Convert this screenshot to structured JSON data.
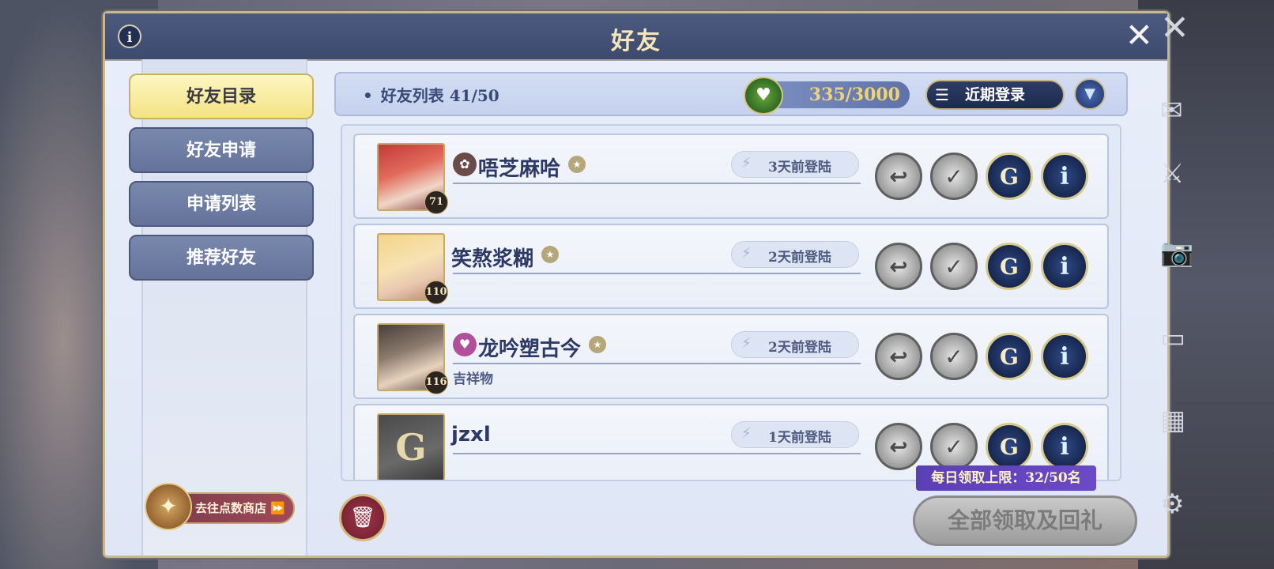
{
  "title": "好友",
  "tabs": [
    {
      "label": "好友目录",
      "active": true
    },
    {
      "label": "好友申请",
      "active": false
    },
    {
      "label": "申请列表",
      "active": false
    },
    {
      "label": "推荐好友",
      "active": false
    }
  ],
  "shop_button": {
    "label": "去往点数商店"
  },
  "header": {
    "friend_count_label": "好友列表 41/50",
    "points": "335/3000",
    "sort_label": "近期登录"
  },
  "friends": [
    {
      "name": "唔芝麻哈",
      "level": "71",
      "login": "3天前登陆",
      "subtitle": ""
    },
    {
      "name": "笑熬浆糊",
      "level": "110",
      "login": "2天前登陆",
      "subtitle": ""
    },
    {
      "name": "龙吟塑古今",
      "level": "116",
      "login": "2天前登陆",
      "subtitle": "吉祥物"
    },
    {
      "name": "jzxl",
      "level": "",
      "login": "1天前登陆",
      "subtitle": ""
    }
  ],
  "claim_tip": "每日领取上限：32/50名",
  "claim_all_label": "全部领取及回礼",
  "icons": {
    "close": "close-icon",
    "info": "info-icon",
    "delete": "trash-icon",
    "sort": "sort-icon",
    "dropdown": "chevron-down-icon"
  },
  "colors": {
    "title_bar": "#3d4a6e",
    "active_tab": "#f3e383",
    "inactive_tab": "#65739a",
    "points_text": "#f1d472",
    "tip_bg": "#5b3fb5"
  }
}
